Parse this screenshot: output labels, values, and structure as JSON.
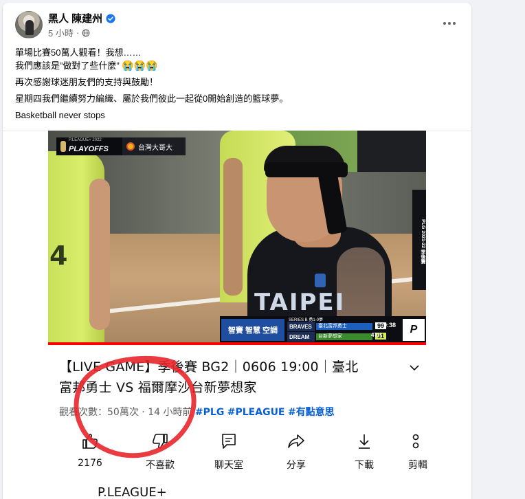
{
  "post": {
    "author": "黑人 陳建州",
    "time": "5 小時",
    "text": {
      "line1": "單場比賽50萬人觀看！我想……",
      "line2": "我們應該是”做對了些什麼”",
      "line2_emoji": "😭😭😭",
      "line3": "再次感謝球迷朋友們的支持與鼓勵！",
      "line4": "星期四我們繼續努力編織、屬於我們彼此一起從0開始創造的籃球夢。",
      "line5": "Basketball never stops"
    }
  },
  "video_overlay": {
    "league": "P.LEAGUE+ 2022",
    "playoffs": "PLAYOFFS",
    "sponsor": "台灣大哥大",
    "side_banner": "PLG 2021-22 季後賽",
    "jersey_text": "TAIPEI",
    "scoreboard": {
      "series": "SERIES B 勇1-0夢",
      "sponsor": "智賽 智慧 空調",
      "team_a_logo": "BRAVES",
      "team_a": "臺北富邦勇士",
      "team_a_score": "99",
      "team_b_logo": "DREAM",
      "team_b": "台新夢想家",
      "team_b_score": "91",
      "clock": "9:38",
      "quarter": "4TH"
    }
  },
  "video_progress_fraction": 1.0,
  "youtube": {
    "title_line1": "【LIVE GAME】季後賽 BG2｜0606 19:00｜臺北",
    "title_line2": "富邦勇士 VS 福爾摩沙台新夢想家",
    "views": "觀看次數：50萬次",
    "age": "14 小時前",
    "tags": [
      "#PLG",
      "#PLEAGUE",
      "#有點意思"
    ],
    "actions": {
      "like_count": "2176",
      "dislike": "不喜歡",
      "chat": "聊天室",
      "share": "分享",
      "download": "下載",
      "clip": "剪輯"
    },
    "channel_name": "P.LEAGUE+"
  },
  "colors": {
    "accent_blue": "#065fd4",
    "fb_verified": "#1877f2",
    "progress_red": "#ff0000",
    "annotation_red": "#e8262b"
  }
}
